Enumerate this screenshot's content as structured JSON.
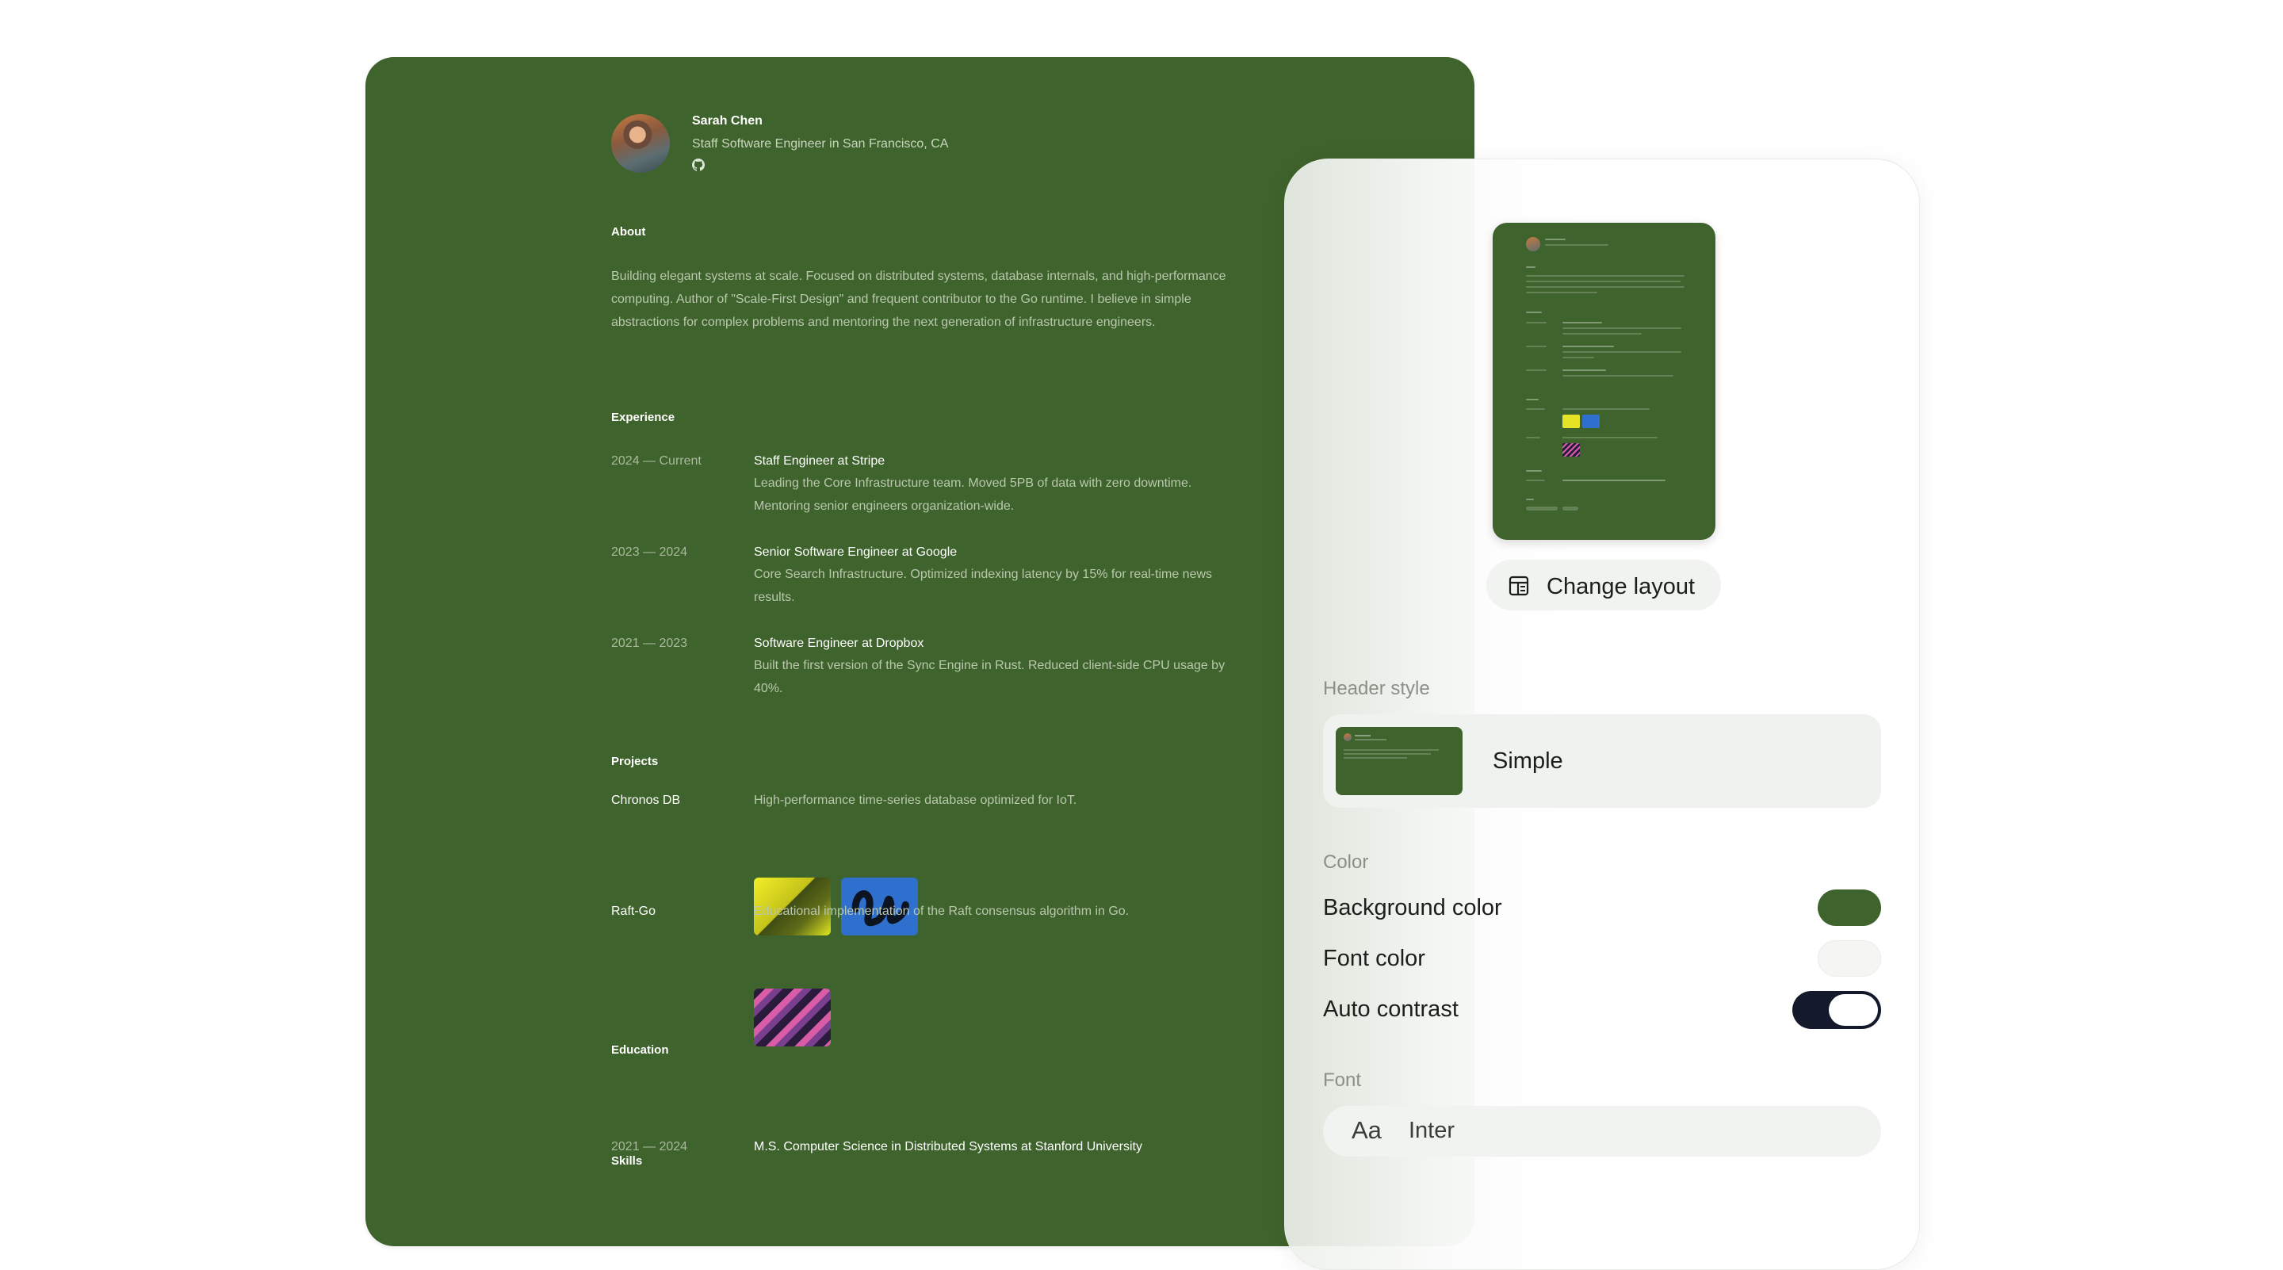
{
  "profile": {
    "name": "Sarah Chen",
    "subtitle": "Staff Software Engineer in San Francisco, CA"
  },
  "about": {
    "title": "About",
    "text": "Building elegant systems at scale. Focused on distributed systems, database internals, and high-performance computing. Author of \"Scale-First Design\" and frequent contributor to the Go runtime. I believe in simple abstractions for complex problems and mentoring the next generation of infrastructure engineers."
  },
  "experience": {
    "title": "Experience",
    "items": [
      {
        "date": "2024 — Current",
        "title": "Staff Engineer at Stripe",
        "desc": "Leading the Core Infrastructure team. Moved 5PB of data with zero downtime. Mentoring senior engineers organization-wide."
      },
      {
        "date": "2023 — 2024",
        "title": "Senior Software Engineer at Google",
        "desc": "Core Search Infrastructure. Optimized indexing latency by 15% for real-time news results."
      },
      {
        "date": "2021 — 2023",
        "title": "Software Engineer at Dropbox",
        "desc": "Built the first version of the Sync Engine in Rust. Reduced client-side CPU usage by 40%."
      }
    ]
  },
  "projects": {
    "title": "Projects",
    "items": [
      {
        "name": "Chronos DB",
        "desc": "High-performance time-series database optimized for IoT."
      },
      {
        "name": "Raft-Go",
        "desc": "Educational implementation of the Raft consensus algorithm in Go."
      }
    ]
  },
  "education": {
    "title": "Education",
    "date": "2021 — 2024",
    "title_text": "M.S. Computer Science in Distributed Systems at Stanford University"
  },
  "skills": {
    "title": "Skills"
  },
  "panel": {
    "change_layout": "Change layout",
    "header_style_label": "Header style",
    "header_style_value": "Simple",
    "color_label": "Color",
    "background_color_label": "Background color",
    "font_color_label": "Font color",
    "auto_contrast_label": "Auto contrast",
    "auto_contrast_on": true,
    "font_label": "Font",
    "font_sample": "Aa",
    "font_value": "Inter"
  },
  "colors": {
    "background": "#3f632c",
    "font": "#f5f5f3",
    "toggle": "#14192b"
  },
  "icons": {
    "github": "github-icon",
    "layout": "layout-icon"
  }
}
